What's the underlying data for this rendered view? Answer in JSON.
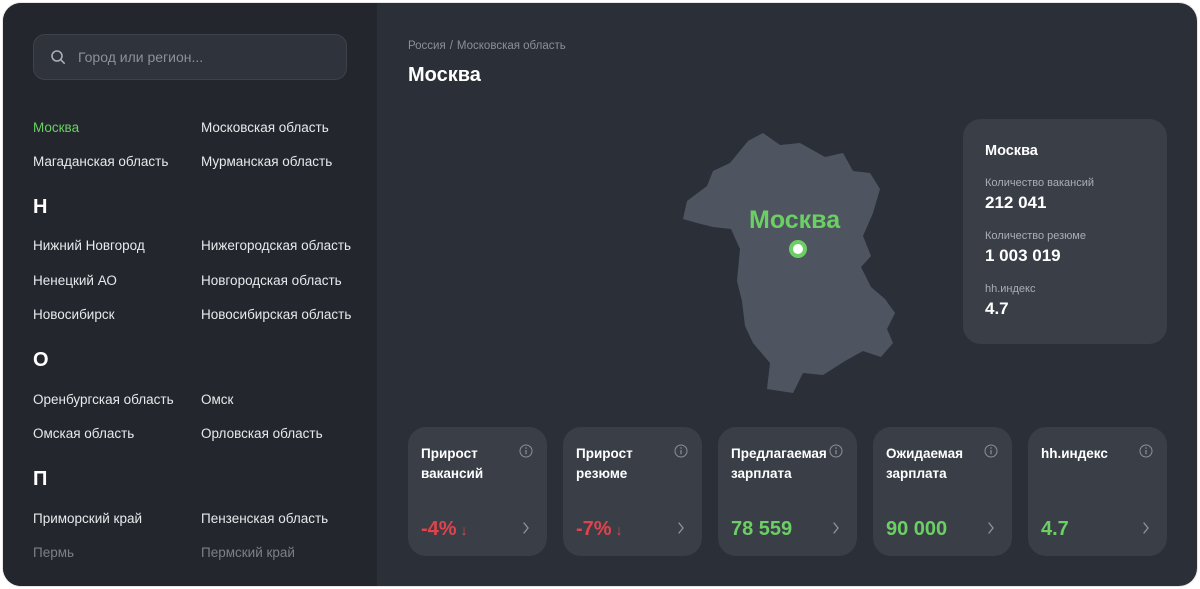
{
  "search": {
    "placeholder": "Город или регион..."
  },
  "sidebar": {
    "rows": [
      {
        "left": "Москва",
        "right": "Московская область",
        "left_active": true
      },
      {
        "left": "Магаданская область",
        "right": "Мурманская область"
      },
      {
        "letter": "Н"
      },
      {
        "left": "Нижний Новгород",
        "right": "Нижегородская область"
      },
      {
        "left": "Ненецкий АО",
        "right": "Новгородская область"
      },
      {
        "left": "Новосибирск",
        "right": "Новосибирская область"
      },
      {
        "letter": "О"
      },
      {
        "left": "Оренбургская область",
        "right": "Омск"
      },
      {
        "left": "Омская область",
        "right": "Орловская область"
      },
      {
        "letter": "П"
      },
      {
        "left": "Приморский край",
        "right": "Пензенская область"
      },
      {
        "left": "Пермь",
        "right": "Пермский край",
        "faded": true
      }
    ]
  },
  "breadcrumb": {
    "root": "Россия",
    "separator": "/",
    "current": "Московская область"
  },
  "page_title": "Москва",
  "map": {
    "label": "Москва",
    "fill_color": "#4f5560",
    "accent": "#6ccf64"
  },
  "info_card": {
    "title": "Москва",
    "vacancies_label": "Количество вакансий",
    "vacancies_value": "212 041",
    "resumes_label": "Количество резюме",
    "resumes_value": "1 003 019",
    "index_label": "hh.индекс",
    "index_value": "4.7"
  },
  "metrics": [
    {
      "title": "Прирост вакансий",
      "value": "-4%",
      "trend": "down",
      "color": "red"
    },
    {
      "title": "Прирост резюме",
      "value": "-7%",
      "trend": "down",
      "color": "red"
    },
    {
      "title": "Предлагаемая зарплата",
      "value": "78 559",
      "color": "green"
    },
    {
      "title": "Ожидаемая зарплата",
      "value": "90 000",
      "color": "green"
    },
    {
      "title": "hh.индекс",
      "value": "4.7",
      "color": "green"
    }
  ],
  "colors": {
    "positive": "#6ccf64",
    "negative": "#e0434c",
    "card": "#3a3f47",
    "background": "#2b2f37",
    "sidebar": "#23262c"
  },
  "icons": {
    "search": "search-icon",
    "info": "info-icon",
    "arrow": "arrow-down-icon",
    "chevron": "chevron-right-icon"
  }
}
